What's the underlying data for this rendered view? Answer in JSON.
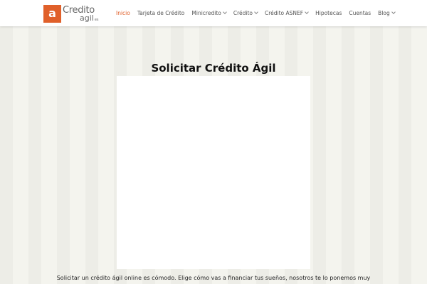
{
  "logo": {
    "mark": "a",
    "line1": "Credito",
    "line2": "agil",
    "suffix": "es"
  },
  "nav": {
    "items": [
      {
        "label": "Inicio",
        "active": true
      },
      {
        "label": "Tarjeta de Crédito"
      },
      {
        "label": "Minicredito",
        "dropdown": true
      },
      {
        "label": "Crédito",
        "dropdown": true
      },
      {
        "label": "Crédito ASNEF",
        "dropdown": true
      },
      {
        "label": "Hipotecas"
      },
      {
        "label": "Cuentas"
      },
      {
        "label": "Blog",
        "dropdown": true
      }
    ]
  },
  "main": {
    "title": "Solicitar Crédito Ágil",
    "intro": "Solicitar un crédito ágil online es cómodo. Elige cómo vas a financiar tus sueños, nosotros te lo ponemos muy"
  },
  "colors": {
    "accent": "#e0602a",
    "background": "#f3f3ee"
  }
}
